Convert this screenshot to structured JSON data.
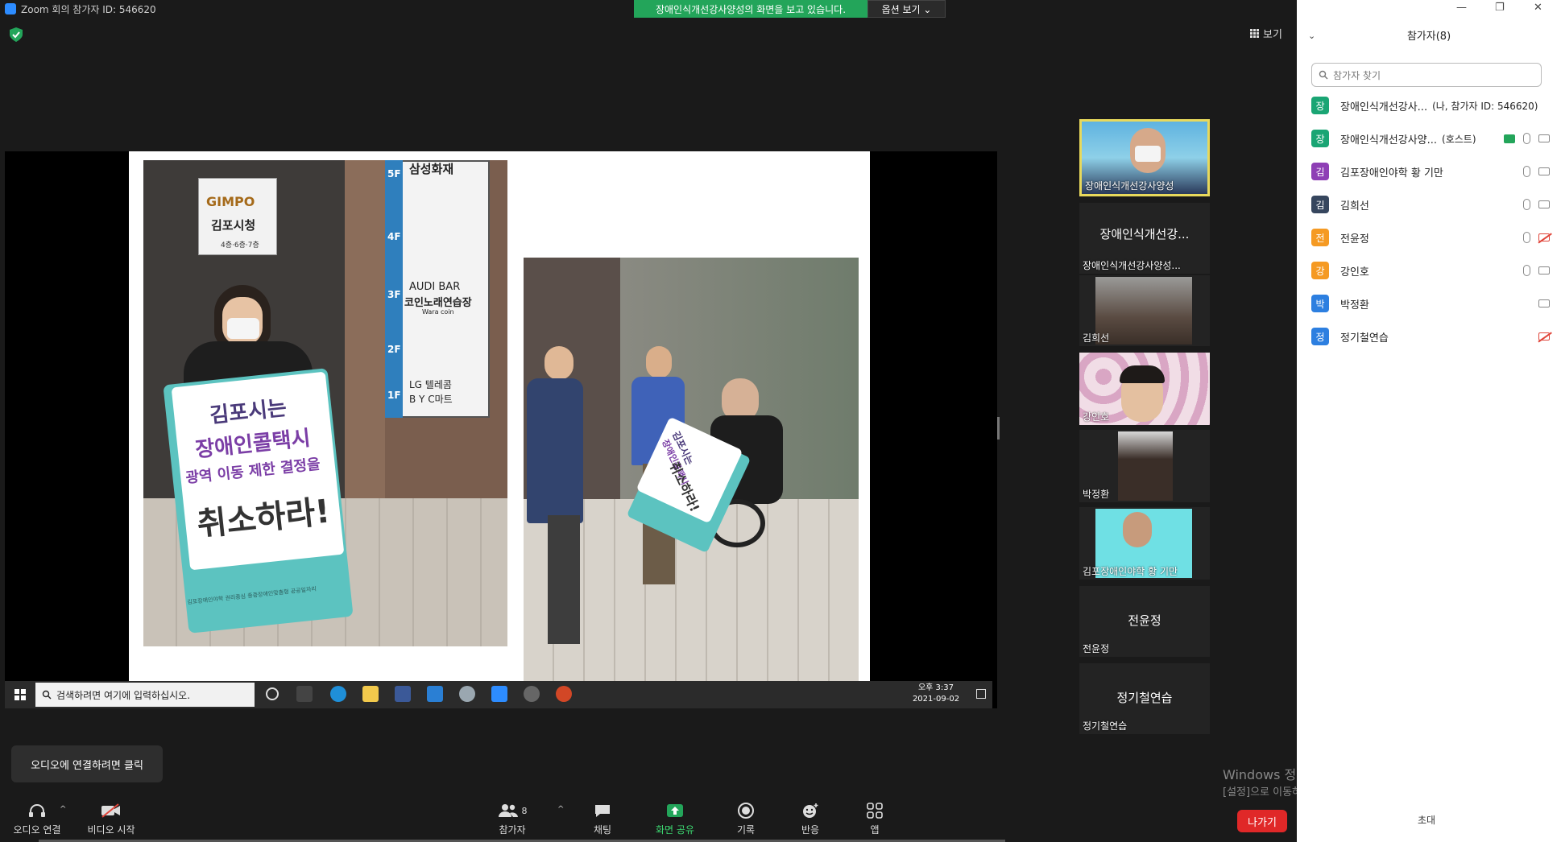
{
  "window": {
    "title": "Zoom 회의 참가자 ID: 546620",
    "share_banner": "장애인식개선강사양성의 화면을 보고 있습니다.",
    "view_options": "옵션 보기 ⌄",
    "view_button": "보기"
  },
  "shared_screen": {
    "photo1_signs": {
      "logo": "GIMPO",
      "city": "김포시청",
      "floors_note": "4층·6층·7층",
      "floor_5f": "5F",
      "floor_4f": "4F",
      "floor_3f": "3F",
      "floor_2f": "2F",
      "floor_1f": "1F",
      "store_top": "삼성화재",
      "store_3f": "AUDI BAR",
      "store_3f_sub": "코인노래연습장",
      "store_3f_tag": "Wara coin",
      "store_1f": "LG 텔레콤",
      "store_1f_sub": "B Y C마트",
      "picket_line1": "김포시는",
      "picket_line2": "장애인콜택시",
      "picket_line3": "광역 이동 제한 결정을",
      "picket_line4": "취소하라!",
      "picket_footer": "김포장애인야학 권리중심 중증장애인맞춤형 공공일자리"
    },
    "photo2_signs": {
      "picket_line1": "김포시는",
      "picket_line2": "장애인콜택시",
      "picket_line4": "취소하라!"
    },
    "taskbar": {
      "search_placeholder": "검색하려면 여기에 입력하십시오.",
      "time": "오후 3:37",
      "date": "2021-09-02"
    }
  },
  "thumbnails": [
    {
      "name": "장애인식개선강사양성",
      "type": "video",
      "active": true
    },
    {
      "name": "장애인식개선강사양성...",
      "big": "장애인식개선강...",
      "type": "name"
    },
    {
      "name": "김희선",
      "type": "video"
    },
    {
      "name": "강인호",
      "type": "video"
    },
    {
      "name": "박정환",
      "type": "video"
    },
    {
      "name": "김포장애인야학 황 기만",
      "type": "video"
    },
    {
      "name": "전윤정",
      "big": "전윤정",
      "type": "name"
    },
    {
      "name": "정기철연습",
      "big": "정기철연습",
      "type": "name"
    }
  ],
  "participants_panel": {
    "title": "참가자(8)",
    "search_placeholder": "참가자 찾기",
    "invite": "초대",
    "participants": [
      {
        "initial": "장",
        "color": "#1aa574",
        "name": "장애인식개선강사...",
        "tag": "(나, 참가자 ID: 546620)",
        "mic": false,
        "cam": false
      },
      {
        "initial": "장",
        "color": "#1aa574",
        "name": "장애인식개선강사양...",
        "tag": "(호스트)",
        "mic": true,
        "cam": "on",
        "share": true
      },
      {
        "initial": "김",
        "color": "#8e3fb5",
        "name": "김포장애인야학  황 기만",
        "tag": "",
        "mic": true,
        "cam": "on"
      },
      {
        "initial": "김",
        "color": "#36465e",
        "name": "김희선",
        "tag": "",
        "mic": true,
        "cam": "on"
      },
      {
        "initial": "전",
        "color": "#f59a23",
        "name": "전윤정",
        "tag": "",
        "mic": true,
        "cam": "off"
      },
      {
        "initial": "강",
        "color": "#f59a23",
        "name": "강인호",
        "tag": "",
        "mic": true,
        "cam": "on"
      },
      {
        "initial": "박",
        "color": "#2d7fe0",
        "name": "박정환",
        "tag": "",
        "mic": false,
        "cam": "on"
      },
      {
        "initial": "정",
        "color": "#2d7fe0",
        "name": "정기철연습",
        "tag": "",
        "mic": false,
        "cam": "off"
      }
    ]
  },
  "toolbar": {
    "audio_tooltip": "오디오에 연결하려면 클릭",
    "audio": "오디오 연결",
    "video": "비디오 시작",
    "participants": "참가자",
    "participants_count": "8",
    "chat": "채팅",
    "share": "화면 공유",
    "record": "기록",
    "reactions": "반응",
    "apps": "앱",
    "leave": "나가기"
  },
  "activation": {
    "line1": "Windows 정품 인증",
    "line2": "[설정]으로 이동하여 Windows를 정품 인증합니다."
  },
  "colors": {
    "share_green": "#23a55a",
    "leave_red": "#e02828",
    "zoom_blue": "#2d8cff",
    "active_border": "#e8d95c"
  }
}
